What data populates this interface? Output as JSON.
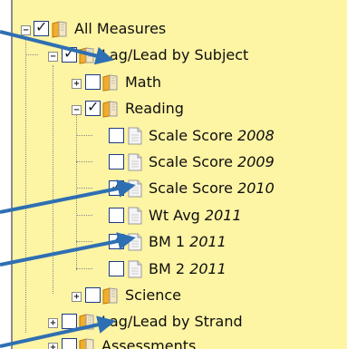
{
  "tree": {
    "root": {
      "label": "All Measures",
      "toggle": "−",
      "checked": true,
      "icon": "folder-icon"
    },
    "lag_lead_subject": {
      "label": "Lag/Lead by Subject",
      "toggle": "−",
      "checked": true,
      "icon": "folder-icon"
    },
    "math": {
      "label": "Math",
      "toggle": "+",
      "checked": false,
      "icon": "folder-icon"
    },
    "reading": {
      "label": "Reading",
      "toggle": "−",
      "checked": true,
      "icon": "folder-icon"
    },
    "scale_2008": {
      "label": "Scale Score ",
      "year": "2008",
      "checked": false,
      "icon": "document-icon"
    },
    "scale_2009": {
      "label": "Scale Score ",
      "year": "2009",
      "checked": false,
      "icon": "document-icon"
    },
    "scale_2010": {
      "label": "Scale Score ",
      "year": "2010",
      "checked": true,
      "icon": "document-icon"
    },
    "wt_avg_2011": {
      "label": "Wt Avg ",
      "year": "2011",
      "checked": false,
      "icon": "document-icon"
    },
    "bm1_2011": {
      "label": "BM 1 ",
      "year": "2011",
      "checked": true,
      "icon": "document-icon"
    },
    "bm2_2011": {
      "label": "BM 2 ",
      "year": "2011",
      "checked": false,
      "icon": "document-icon"
    },
    "science": {
      "label": "Science",
      "toggle": "+",
      "checked": false,
      "icon": "folder-icon"
    },
    "lag_lead_strand": {
      "label": "Lag/Lead by Strand",
      "toggle": "+",
      "checked": false,
      "icon": "folder-icon"
    },
    "assessments": {
      "label": "Assessments",
      "toggle": "+",
      "checked": false,
      "icon": "folder-icon"
    }
  },
  "check_mark": "✓",
  "colors": {
    "panel_bg": "#fdf4a4",
    "arrow": "#2e6fb3",
    "checkbox_border": "#1c3a8a"
  }
}
